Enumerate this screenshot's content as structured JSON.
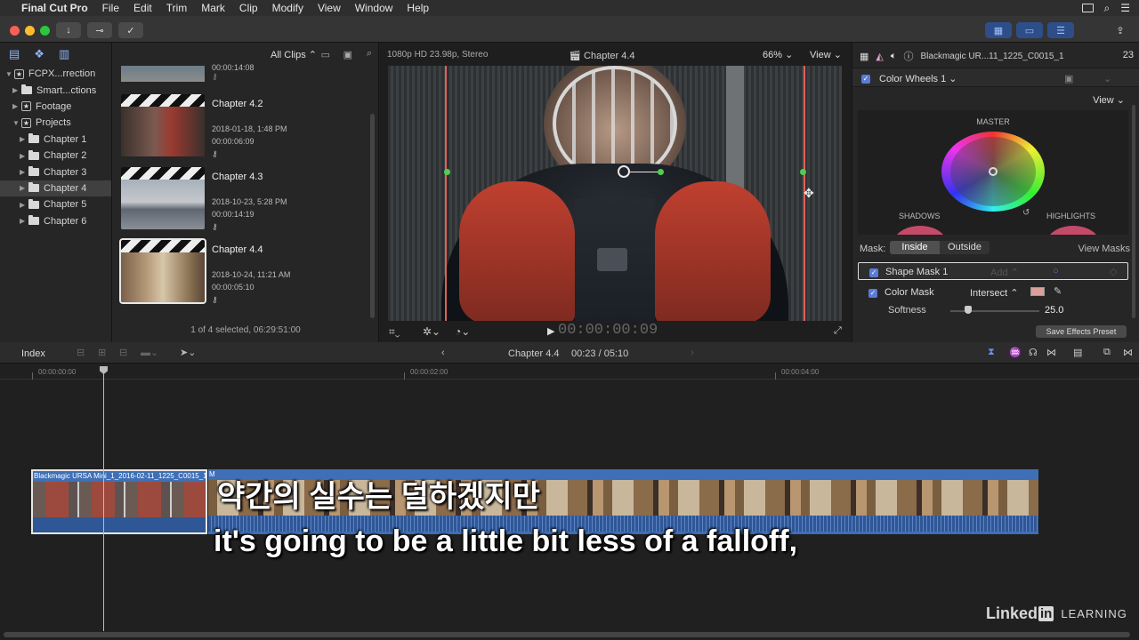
{
  "menubar": {
    "app": "Final Cut Pro",
    "items": [
      "File",
      "Edit",
      "Trim",
      "Mark",
      "Clip",
      "Modify",
      "View",
      "Window",
      "Help"
    ]
  },
  "libraries": {
    "items": [
      {
        "label": "FCPX...rrection",
        "indent": 0,
        "type": "lib",
        "open": true
      },
      {
        "label": "Smart...ctions",
        "indent": 1,
        "type": "folder",
        "open": false
      },
      {
        "label": "Footage",
        "indent": 1,
        "type": "event",
        "open": false
      },
      {
        "label": "Projects",
        "indent": 1,
        "type": "event",
        "open": true
      },
      {
        "label": "Chapter 1",
        "indent": 2,
        "type": "folder",
        "open": false
      },
      {
        "label": "Chapter 2",
        "indent": 2,
        "type": "folder",
        "open": false
      },
      {
        "label": "Chapter 3",
        "indent": 2,
        "type": "folder",
        "open": false
      },
      {
        "label": "Chapter 4",
        "indent": 2,
        "type": "folder",
        "open": false,
        "selected": true
      },
      {
        "label": "Chapter 5",
        "indent": 2,
        "type": "folder",
        "open": false
      },
      {
        "label": "Chapter 6",
        "indent": 2,
        "type": "folder",
        "open": false
      }
    ]
  },
  "browser": {
    "filter": "All Clips",
    "top_duration": "00:00:14:08",
    "clips": [
      {
        "title": "Chapter 4.2",
        "date": "2018-01-18, 1:48 PM",
        "duration": "00:00:06:09"
      },
      {
        "title": "Chapter 4.3",
        "date": "2018-10-23, 5:28 PM",
        "duration": "00:00:14:19"
      },
      {
        "title": "Chapter 4.4",
        "date": "2018-10-24, 11:21 AM",
        "duration": "00:00:05:10"
      }
    ],
    "status": "1 of 4 selected, 06:29:51:00"
  },
  "viewer": {
    "format": "1080p HD 23.98p, Stereo",
    "title": "Chapter 4.4",
    "zoom": "66%",
    "view_label": "View",
    "timecode": "00:00:00:09"
  },
  "inspector": {
    "clip_name": "Blackmagic UR...11_1225_C0015_1",
    "frame_count": "23",
    "effect": "Color Wheels 1",
    "view_label": "View",
    "master": "MASTER",
    "shadows": "SHADOWS",
    "highlights": "HIGHLIGHTS",
    "mask_label": "Mask:",
    "inside": "Inside",
    "outside": "Outside",
    "view_masks": "View Masks",
    "shape_mask": "Shape Mask 1",
    "add": "Add",
    "color_mask": "Color Mask",
    "intersect": "Intersect",
    "softness_label": "Softness",
    "softness_value": "25.0",
    "softness_level": 0.2,
    "save_preset": "Save Effects Preset"
  },
  "timeline": {
    "index": "Index",
    "project": "Chapter 4.4",
    "position": "00:23 / 05:10",
    "ruler": [
      "00:00:00:00",
      "00:00:02:00",
      "00:00:04:00"
    ],
    "clip1_name": "Blackmagic URSA Mini_1_2016-02-11_1225_C0015_1",
    "clip2_name": "M"
  },
  "subtitles": {
    "korean": "약간의 실수는 덜하겠지만",
    "english": "it's going to be a little bit less of a falloff,"
  },
  "watermark": {
    "brand_a": "Linked",
    "brand_b": "in",
    "brand_c": "LEARNING"
  },
  "colors": {
    "accent": "#5a7bd6",
    "mask_line": "#e0625a",
    "clip_blue": "#3f6fb6"
  }
}
